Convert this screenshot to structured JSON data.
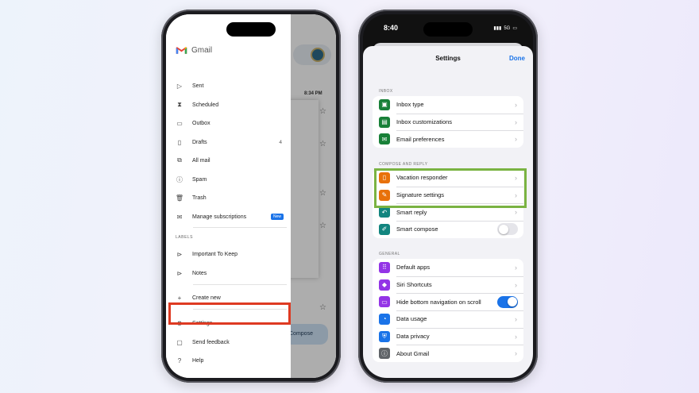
{
  "gmail": {
    "app_name": "Gmail",
    "menu": [
      {
        "label": "Sent",
        "icon": "send-icon"
      },
      {
        "label": "Scheduled",
        "icon": "scheduled-icon"
      },
      {
        "label": "Outbox",
        "icon": "outbox-icon"
      },
      {
        "label": "Drafts",
        "icon": "draft-icon",
        "count": "4"
      },
      {
        "label": "All mail",
        "icon": "all-mail-icon"
      },
      {
        "label": "Spam",
        "icon": "spam-icon"
      },
      {
        "label": "Trash",
        "icon": "trash-icon"
      },
      {
        "label": "Manage subscriptions",
        "icon": "subscriptions-icon",
        "badge": "New"
      }
    ],
    "labels_heading": "LABELS",
    "labels": [
      {
        "label": "Important To Keep",
        "icon": "label-icon"
      },
      {
        "label": "Notes",
        "icon": "label-icon"
      }
    ],
    "create_new": "Create new",
    "settings": "Settings",
    "send_feedback": "Send feedback",
    "help": "Help",
    "background": {
      "times": [
        "8:34 PM"
      ],
      "compose_label": "Compose"
    }
  },
  "ios": {
    "status_time": "8:40",
    "status_network": "5G",
    "title": "Settings",
    "done": "Done",
    "groups": [
      {
        "heading": "INBOX",
        "rows": [
          {
            "label": "Inbox type",
            "icon": "inbox-type-icon",
            "color": "#188038"
          },
          {
            "label": "Inbox customizations",
            "icon": "inbox-custom-icon",
            "color": "#188038"
          },
          {
            "label": "Email preferences",
            "icon": "email-pref-icon",
            "color": "#188038"
          }
        ]
      },
      {
        "heading": "COMPOSE AND REPLY",
        "rows": [
          {
            "label": "Vacation responder",
            "icon": "vacation-icon",
            "color": "#e8710a"
          },
          {
            "label": "Signature settings",
            "icon": "signature-icon",
            "color": "#e8710a"
          },
          {
            "label": "Smart reply",
            "icon": "smart-reply-icon",
            "color": "#12857f"
          },
          {
            "label": "Smart compose",
            "icon": "smart-compose-icon",
            "color": "#12857f",
            "toggle": "off"
          }
        ]
      },
      {
        "heading": "GENERAL",
        "rows": [
          {
            "label": "Default apps",
            "icon": "default-apps-icon",
            "color": "#9334e6"
          },
          {
            "label": "Siri Shortcuts",
            "icon": "siri-icon",
            "color": "#9334e6"
          },
          {
            "label": "Hide bottom navigation on scroll",
            "icon": "hide-nav-icon",
            "color": "#9334e6",
            "toggle": "on"
          },
          {
            "label": "Data usage",
            "icon": "data-usage-icon",
            "color": "#1a73e8"
          },
          {
            "label": "Data privacy",
            "icon": "privacy-icon",
            "color": "#1a73e8"
          },
          {
            "label": "About Gmail",
            "icon": "info-icon",
            "color": "#5f6368"
          }
        ]
      }
    ]
  }
}
